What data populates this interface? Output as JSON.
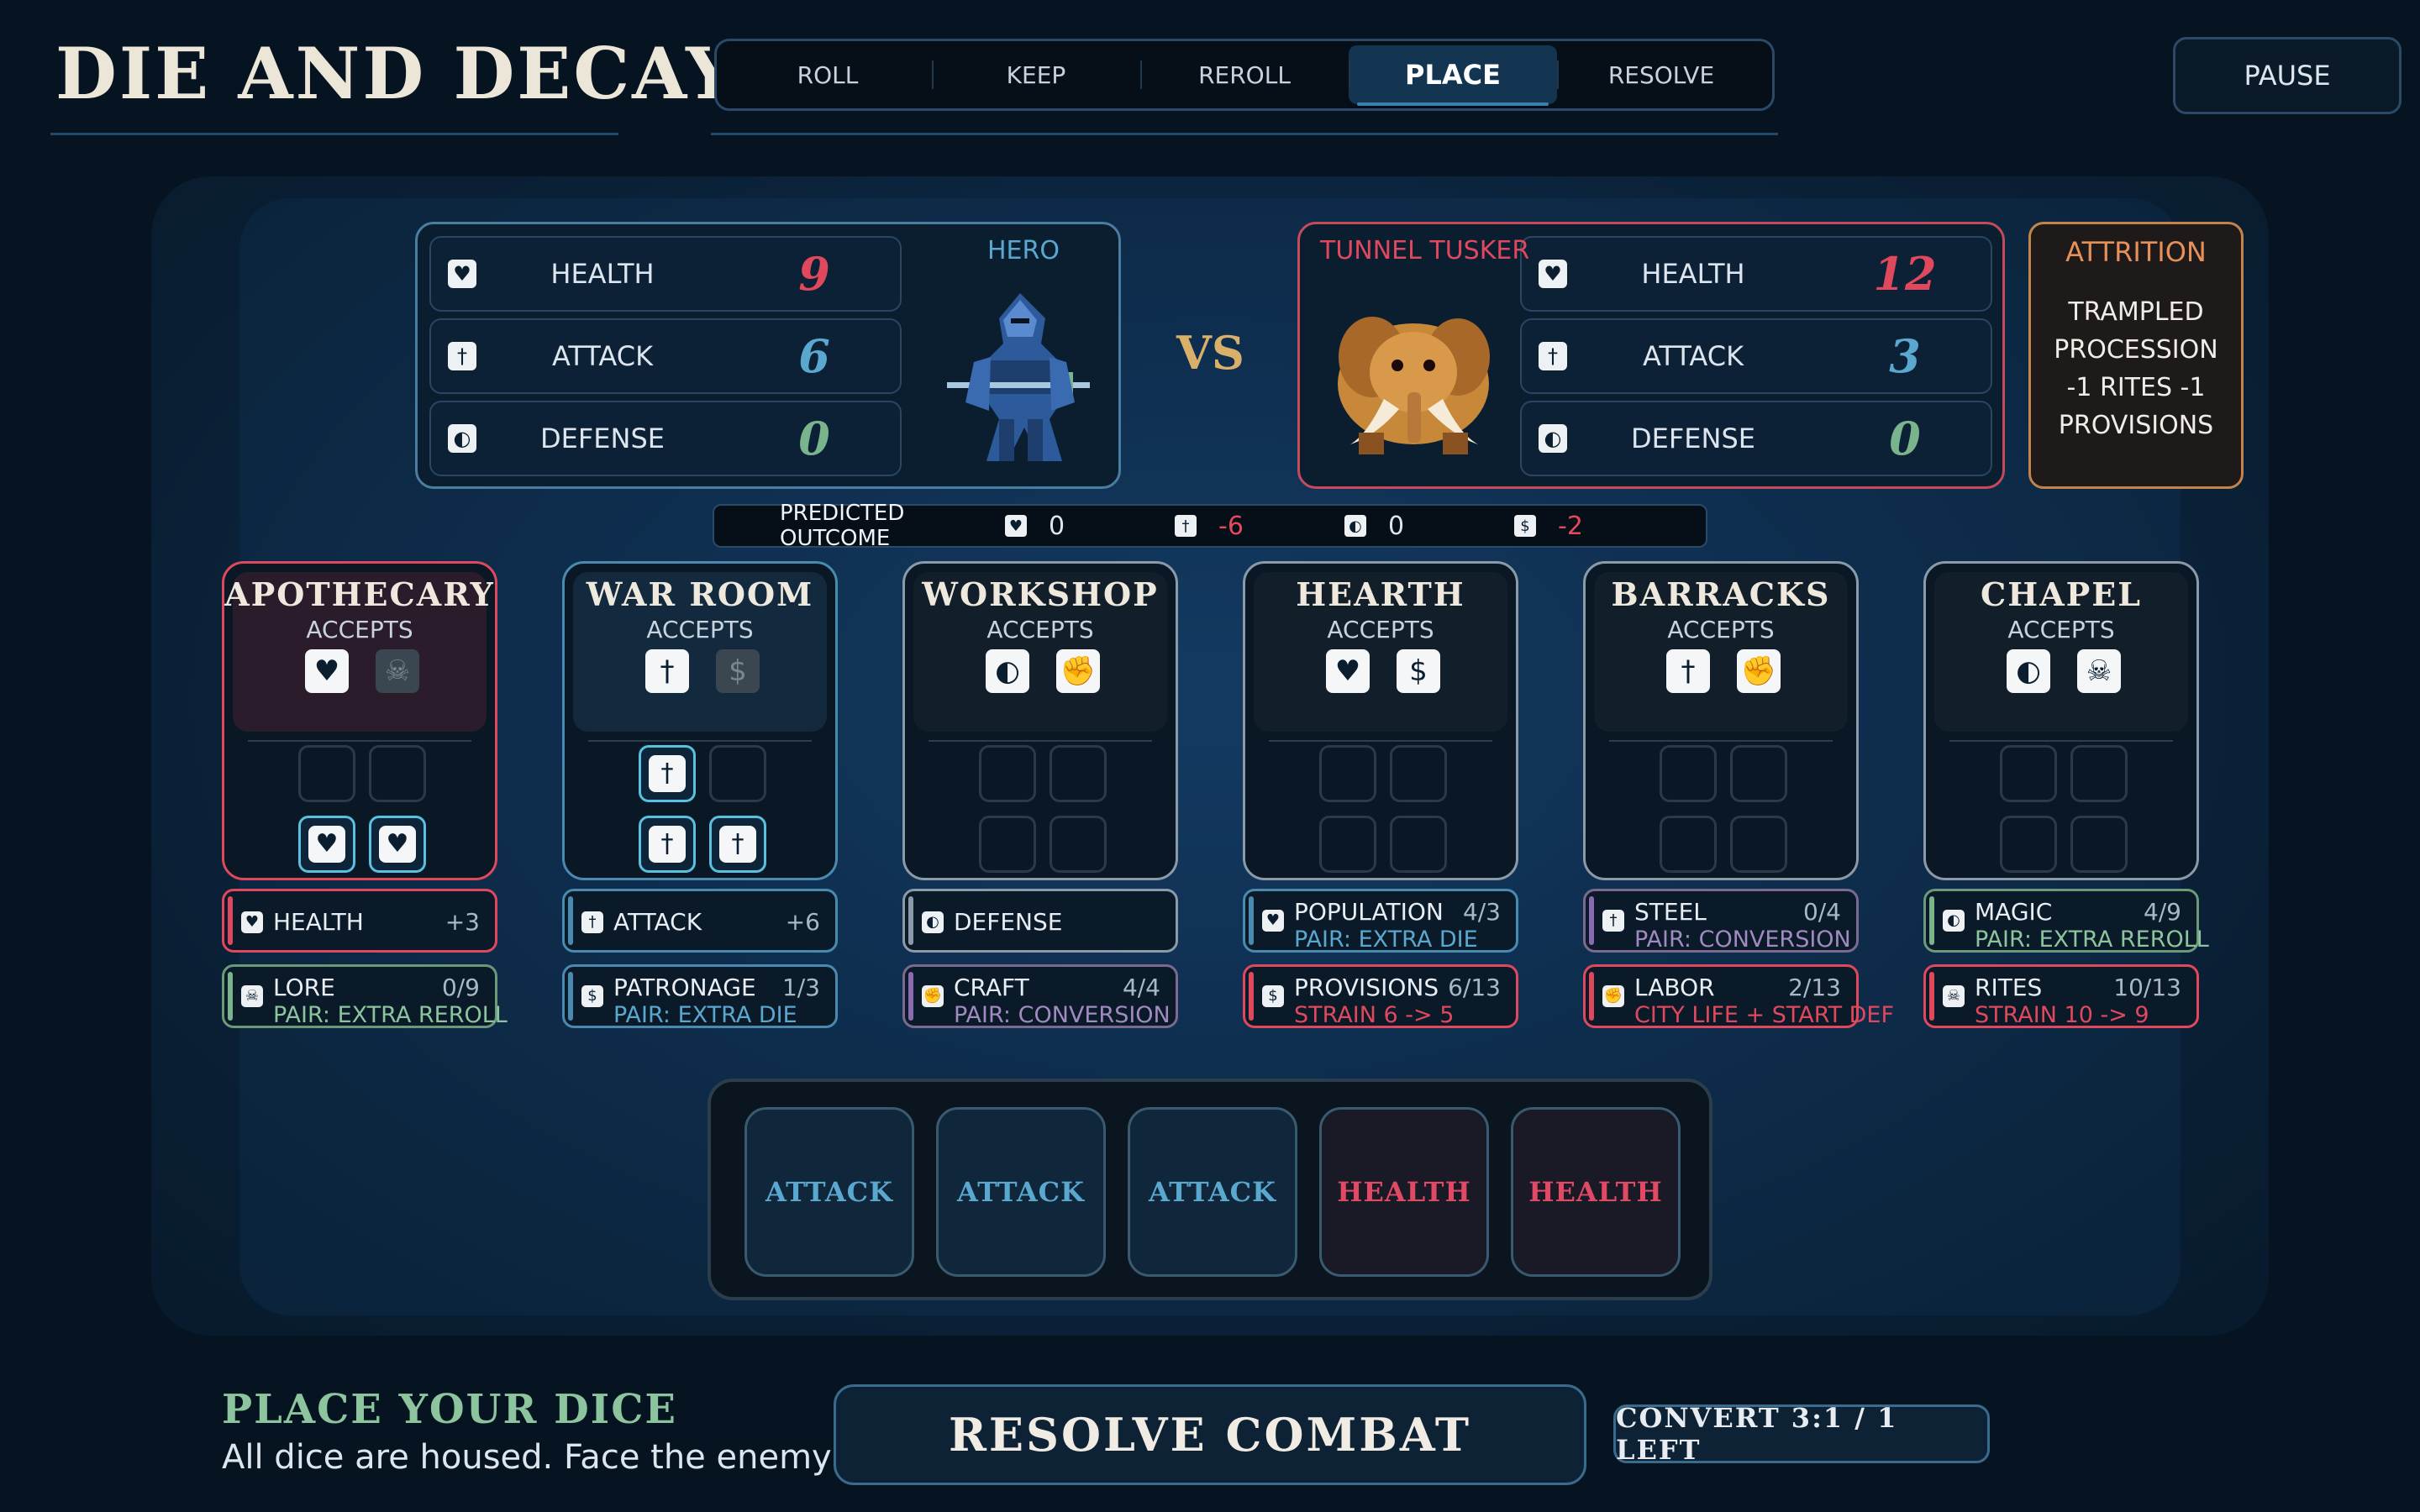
{
  "game_title": "DIE AND DECAY",
  "phases": [
    "ROLL",
    "KEEP",
    "REROLL",
    "PLACE",
    "RESOLVE"
  ],
  "active_phase": "PLACE",
  "pause_label": "PAUSE",
  "hero": {
    "name": "HERO",
    "stats": [
      {
        "label": "HEALTH",
        "value": "9",
        "icon": "heart-icon",
        "color": "#e0485e"
      },
      {
        "label": "ATTACK",
        "value": "6",
        "icon": "sword-icon",
        "color": "#5aa8d0"
      },
      {
        "label": "DEFENSE",
        "value": "0",
        "icon": "shield-icon",
        "color": "#7ab48c"
      }
    ]
  },
  "vs_label": "VS",
  "enemy": {
    "name": "TUNNEL TUSKER",
    "stats": [
      {
        "label": "HEALTH",
        "value": "12",
        "icon": "heart-icon",
        "color": "#e0485e"
      },
      {
        "label": "ATTACK",
        "value": "3",
        "icon": "sword-icon",
        "color": "#5aa8d0"
      },
      {
        "label": "DEFENSE",
        "value": "0",
        "icon": "shield-icon",
        "color": "#7ab48c"
      }
    ]
  },
  "attrition": {
    "title": "ATTRITION",
    "lines": [
      "TRAMPLED",
      "PROCESSION",
      "-1 RITES  -1",
      "PROVISIONS"
    ]
  },
  "predicted": {
    "label": "PREDICTED OUTCOME",
    "items": [
      {
        "icon": "heart-icon",
        "value": "0",
        "color": "#dde6ee"
      },
      {
        "icon": "sword-icon",
        "value": "-6",
        "color": "#e04a5a"
      },
      {
        "icon": "shield-icon",
        "value": "0",
        "color": "#dde6ee"
      },
      {
        "icon": "coin-icon",
        "value": "-2",
        "color": "#e04a5a"
      }
    ]
  },
  "buildings": [
    {
      "name": "APOTHECARY",
      "accepts_label": "ACCEPTS",
      "accepts": [
        {
          "icon": "heart-icon",
          "enabled": true
        },
        {
          "icon": "skull-icon",
          "enabled": false
        }
      ],
      "border": "#e0485e",
      "head": "#2a1c2a",
      "slots": [
        "empty",
        "empty",
        "heart-die",
        "heart-die"
      ],
      "resources": [
        {
          "icon": "heart-icon",
          "name": "HEALTH",
          "value": "+3",
          "sub": "",
          "bar": "#e0485e",
          "border": "#e0485e",
          "sub_color": "#8cc49e"
        },
        {
          "icon": "skull-icon",
          "name": "LORE",
          "value": "0/9",
          "sub": "PAIR: EXTRA REROLL",
          "bar": "#7ab48c",
          "border": "#6a9a7a",
          "sub_color": "#8cc49e"
        }
      ]
    },
    {
      "name": "WAR ROOM",
      "accepts_label": "ACCEPTS",
      "accepts": [
        {
          "icon": "sword-icon",
          "enabled": true
        },
        {
          "icon": "coin-icon",
          "enabled": false
        }
      ],
      "border": "#4a8ab0",
      "head": "#132a3e",
      "slots": [
        "sword-die",
        "empty",
        "sword-die",
        "sword-die"
      ],
      "resources": [
        {
          "icon": "sword-icon",
          "name": "ATTACK",
          "value": "+6",
          "sub": "",
          "bar": "#4a8ab0",
          "border": "#4a8ab0",
          "sub_color": "#8cc49e"
        },
        {
          "icon": "coin-icon",
          "name": "PATRONAGE",
          "value": "1/3",
          "sub": "PAIR: EXTRA DIE",
          "bar": "#4a8ab0",
          "border": "#4a8ab0",
          "sub_color": "#5aa8d0"
        }
      ]
    },
    {
      "name": "WORKSHOP",
      "accepts_label": "ACCEPTS",
      "accepts": [
        {
          "icon": "shield-icon",
          "enabled": true
        },
        {
          "icon": "fist-icon",
          "enabled": true
        }
      ],
      "border": "#8a9aa8",
      "head": "#121e2a",
      "slots": [
        "empty",
        "empty",
        "empty",
        "empty"
      ],
      "resources": [
        {
          "icon": "shield-icon",
          "name": "DEFENSE",
          "value": "",
          "sub": "",
          "bar": "#8a9aa8",
          "border": "#8a9aa8",
          "sub_color": "#8cc49e"
        },
        {
          "icon": "fist-icon",
          "name": "CRAFT",
          "value": "4/4",
          "sub": "PAIR: CONVERSION",
          "bar": "#8a6ab0",
          "border": "#7a6a90",
          "sub_color": "#a08ac0"
        }
      ]
    },
    {
      "name": "HEARTH",
      "accepts_label": "ACCEPTS",
      "accepts": [
        {
          "icon": "heart-icon",
          "enabled": true
        },
        {
          "icon": "coin-icon",
          "enabled": true
        }
      ],
      "border": "#8a9aa8",
      "head": "#121e2a",
      "slots": [
        "empty",
        "empty",
        "empty",
        "empty"
      ],
      "resources": [
        {
          "icon": "heart-icon",
          "name": "POPULATION",
          "value": "4/3",
          "sub": "PAIR: EXTRA DIE",
          "bar": "#4a8ab0",
          "border": "#4a8ab0",
          "sub_color": "#5aa8d0"
        },
        {
          "icon": "coin-icon",
          "name": "PROVISIONS",
          "value": "6/13",
          "sub": "STRAIN 6 -> 5",
          "bar": "#e0485e",
          "border": "#e0485e",
          "sub_color": "#e0485e"
        }
      ]
    },
    {
      "name": "BARRACKS",
      "accepts_label": "ACCEPTS",
      "accepts": [
        {
          "icon": "sword-icon",
          "enabled": true
        },
        {
          "icon": "fist-icon",
          "enabled": true
        }
      ],
      "border": "#8a9aa8",
      "head": "#121e2a",
      "slots": [
        "empty",
        "empty",
        "empty",
        "empty"
      ],
      "resources": [
        {
          "icon": "sword-icon",
          "name": "STEEL",
          "value": "0/4",
          "sub": "PAIR: CONVERSION",
          "bar": "#8a6ab0",
          "border": "#7a6a90",
          "sub_color": "#a08ac0"
        },
        {
          "icon": "fist-icon",
          "name": "LABOR",
          "value": "2/13",
          "sub": "CITY LIFE + START DEF",
          "bar": "#e0485e",
          "border": "#e0485e",
          "sub_color": "#e0485e"
        }
      ]
    },
    {
      "name": "CHAPEL",
      "accepts_label": "ACCEPTS",
      "accepts": [
        {
          "icon": "shield-icon",
          "enabled": true
        },
        {
          "icon": "skull-icon",
          "enabled": true
        }
      ],
      "border": "#8a9aa8",
      "head": "#121e2a",
      "slots": [
        "empty",
        "empty",
        "empty",
        "empty"
      ],
      "resources": [
        {
          "icon": "shield-icon",
          "name": "MAGIC",
          "value": "4/9",
          "sub": "PAIR: EXTRA REROLL",
          "bar": "#7ab48c",
          "border": "#6a9a7a",
          "sub_color": "#8cc49e"
        },
        {
          "icon": "skull-icon",
          "name": "RITES",
          "value": "10/13",
          "sub": "STRAIN 10 -> 9",
          "bar": "#e0485e",
          "border": "#e0485e",
          "sub_color": "#e0485e"
        }
      ]
    }
  ],
  "dice": [
    {
      "label": "ATTACK",
      "kind": "attack"
    },
    {
      "label": "ATTACK",
      "kind": "attack"
    },
    {
      "label": "ATTACK",
      "kind": "attack"
    },
    {
      "label": "HEALTH",
      "kind": "health"
    },
    {
      "label": "HEALTH",
      "kind": "health"
    }
  ],
  "footer": {
    "title": "PLACE YOUR DICE",
    "subtitle": "All dice are housed. Face the enemy when ready.",
    "resolve_label": "RESOLVE COMBAT",
    "convert_label": "CONVERT 3:1 / 1 LEFT"
  }
}
